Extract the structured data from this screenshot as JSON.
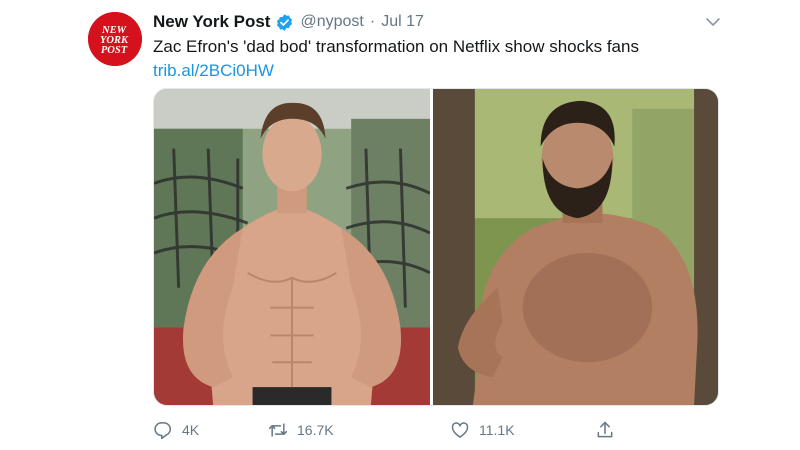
{
  "tweet": {
    "display_name": "New York Post",
    "verified": true,
    "handle": "@nypost",
    "separator": "·",
    "timestamp": "Jul 17",
    "text": "Zac Efron's 'dad bod' transformation on Netflix show shocks fans",
    "link": "trib.al/2BCi0HW",
    "avatar": {
      "lines": [
        "NEW",
        "YORK",
        "POST"
      ],
      "color": "#d4111c"
    },
    "media": [
      {
        "icon": "photo-fit-physique"
      },
      {
        "icon": "photo-dad-bod"
      }
    ],
    "actions": {
      "reply_count": "4K",
      "retweet_count": "16.7K",
      "like_count": "11.1K"
    }
  },
  "colors": {
    "link": "#1b95e0",
    "secondary_text": "#657786",
    "verified_badge": "#1da1f2",
    "brand_red": "#d4111c"
  }
}
